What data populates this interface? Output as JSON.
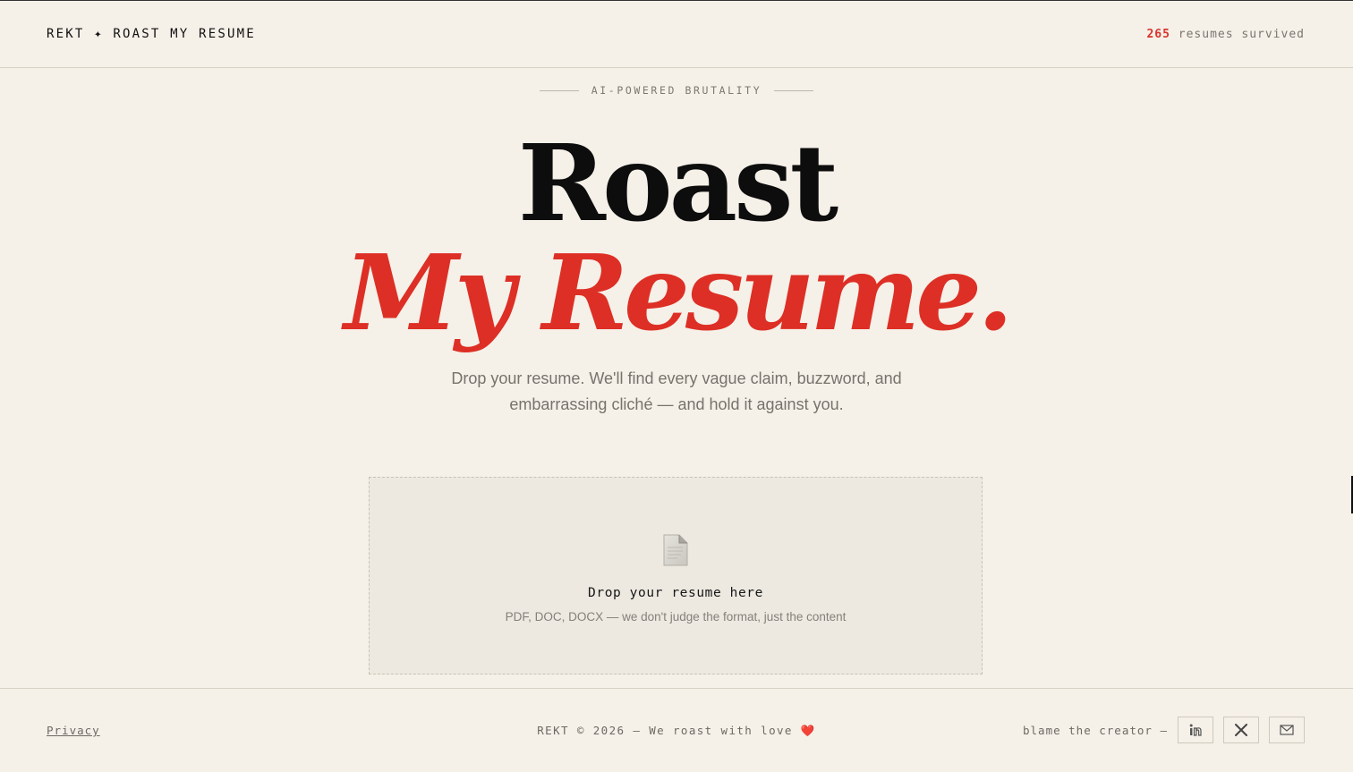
{
  "header": {
    "brand": "REKT ✦ ROAST MY RESUME",
    "counter_number": "265",
    "counter_text": " resumes survived"
  },
  "hero": {
    "eyebrow": "AI-POWERED BRUTALITY",
    "title_line1": "Roast",
    "title_line2": "My Resume.",
    "subtitle": "Drop your resume. We'll find every vague claim, buzzword, and embarrassing cliché — and hold it against you."
  },
  "dropzone": {
    "icon": "document-icon",
    "title": "Drop your resume here",
    "hint": "PDF, DOC, DOCX — we don't judge the format, just the content"
  },
  "footer": {
    "privacy_label": "Privacy",
    "copyright": "REKT © 2026 — We roast with love",
    "heart": "❤️",
    "blame_label": "blame the creator —",
    "social": [
      {
        "icon": "linkedin-icon"
      },
      {
        "icon": "x-icon"
      },
      {
        "icon": "mail-icon"
      }
    ]
  },
  "colors": {
    "background": "#f5f0e8",
    "accent": "#dd2f25",
    "text": "#111111",
    "muted": "#77736c"
  }
}
